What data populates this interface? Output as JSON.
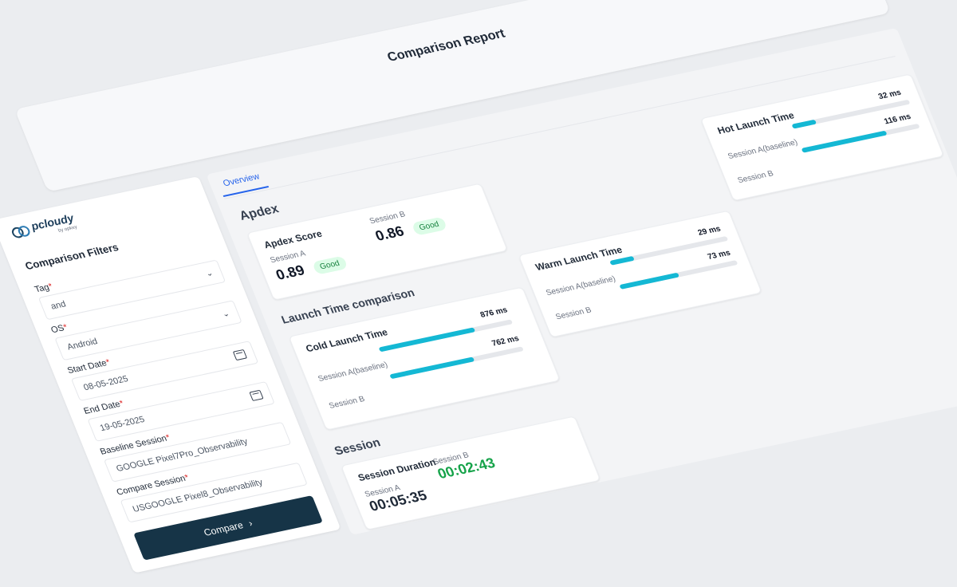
{
  "header": {
    "title": "Comparison Report"
  },
  "sidebar": {
    "logo": {
      "text": "pcloudy",
      "sub": "by opkey"
    },
    "filters_title": "Comparison Filters",
    "fields": [
      {
        "label": "Tag",
        "value": "and",
        "kind": "select"
      },
      {
        "label": "OS",
        "value": "Android",
        "kind": "select"
      },
      {
        "label": "Start Date",
        "value": "08-05-2025",
        "kind": "date"
      },
      {
        "label": "End Date",
        "value": "19-05-2025",
        "kind": "date"
      },
      {
        "label": "Baseline Session",
        "value": "GOOGLE Pixel7Pro_Observability",
        "kind": "text"
      },
      {
        "label": "Compare Session",
        "value": "USGOOGLE Pixel8_Observability",
        "kind": "text"
      }
    ],
    "compare_label": "Compare",
    "compare_icon": "chevron-right-icon"
  },
  "tabs": [
    {
      "label": "Overview",
      "active": true
    }
  ],
  "apdex": {
    "section_title": "Apdex",
    "score_card": {
      "title": "Apdex Score",
      "session_a": {
        "label": "Session A",
        "score": "0.89",
        "badge": "Good"
      },
      "session_b": {
        "label": "Session B",
        "score": "0.86",
        "badge": "Good"
      }
    },
    "hot_launch": {
      "title": "Hot Launch Time",
      "label_a": "Session A(baseline)",
      "label_b": "Session B",
      "value_a": "32 ms",
      "value_b": "116 ms",
      "fill_a": 0.2,
      "fill_b": 0.72
    }
  },
  "launch": {
    "section_title": "Launch Time comparison",
    "cold": {
      "title": "Cold Launch Time",
      "label_a": "Session A(baseline)",
      "label_b": "Session B",
      "value_a": "876 ms",
      "value_b": "762 ms",
      "fill_a": 0.72,
      "fill_b": 0.63
    },
    "warm": {
      "title": "Warm Launch Time",
      "label_a": "Session A(baseline)",
      "label_b": "Session B",
      "value_a": "29 ms",
      "value_b": "73 ms",
      "fill_a": 0.2,
      "fill_b": 0.5
    }
  },
  "session": {
    "section_title": "Session",
    "duration_card": {
      "title": "Session Duration",
      "session_a": {
        "label": "Session A",
        "value": "00:05:35"
      },
      "session_b": {
        "label": "Session B",
        "value": "00:02:43"
      }
    }
  },
  "colors": {
    "bar": "#14b8d4",
    "button": "#163447",
    "good": "#16a34a",
    "tab_active": "#2563eb"
  }
}
